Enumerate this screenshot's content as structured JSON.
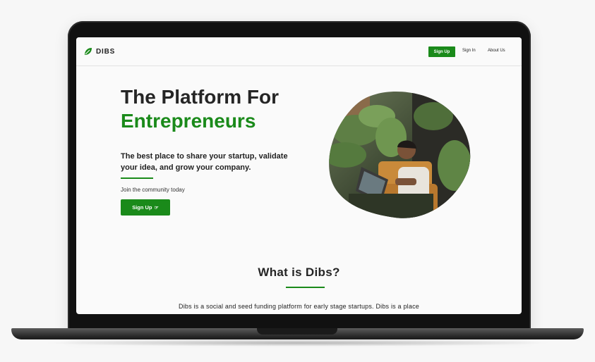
{
  "nav": {
    "logo_text": "DIBS",
    "signup_label": "Sign Up",
    "signin_label": "Sign In",
    "about_label": "About Us"
  },
  "hero": {
    "title_line1": "The Platform For",
    "title_line2": "Entrepreneurs",
    "description": "The best place to share your startup, validate your idea, and grow your company.",
    "join_text": "Join the community today",
    "button_label": "Sign Up",
    "button_icon": "pointing-hand-icon"
  },
  "what": {
    "title": "What is Dibs?",
    "text": "Dibs is a social and seed funding platform for early stage startups. Dibs is a place"
  },
  "colors": {
    "brand_green": "#1a8a1a",
    "text_dark": "#252525",
    "screen_bg": "#fafafa",
    "laptop_bezel": "#111111"
  }
}
